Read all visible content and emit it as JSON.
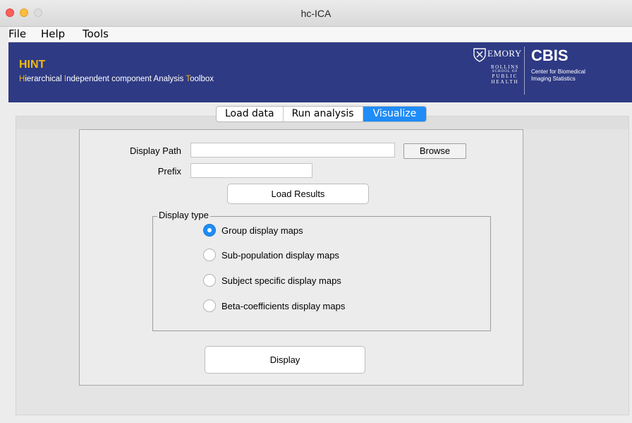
{
  "window": {
    "title": "hc-ICA"
  },
  "menubar": {
    "items": [
      "File",
      "Help",
      "Tools"
    ]
  },
  "banner": {
    "app_name": "HINT",
    "subtitle_parts": [
      "H",
      "ierarchical ",
      "I",
      "ndependent component Analysis ",
      "T",
      "oolbox"
    ],
    "emory": "EMORY",
    "rollins_lines": [
      "ROLLINS",
      "SCHOOL OF",
      "PUBLIC",
      "HEALTH"
    ],
    "cbis": "CBIS",
    "cbis_sub_lines": [
      "Center for Biomedical",
      "Imaging Statistics"
    ],
    "colors": {
      "background": "#2e3a84",
      "accent": "#f2b90e"
    }
  },
  "tabs": [
    {
      "label": "Load data",
      "active": false
    },
    {
      "label": "Run analysis",
      "active": false
    },
    {
      "label": "Visualize",
      "active": true
    }
  ],
  "form": {
    "display_path_label": "Display Path",
    "display_path_value": "",
    "browse_label": "Browse",
    "prefix_label": "Prefix",
    "prefix_value": "",
    "load_results_label": "Load Results"
  },
  "display_type": {
    "title": "Display type",
    "options": [
      {
        "label": "Group display maps",
        "selected": true
      },
      {
        "label": "Sub-population display maps",
        "selected": false
      },
      {
        "label": "Subject specific display maps",
        "selected": false
      },
      {
        "label": "Beta-coefficients display maps",
        "selected": false
      }
    ]
  },
  "display_button_label": "Display",
  "colors": {
    "accent": "#1f8cf7"
  }
}
